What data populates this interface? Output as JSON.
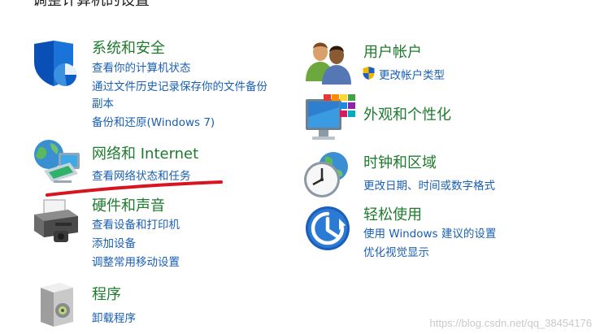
{
  "header": {
    "title": "调整计算机的设置"
  },
  "categories": {
    "system": {
      "title": "系统和安全",
      "links": [
        "查看你的计算机状态",
        "通过文件历史记录保存你的文件备份",
        "副本",
        "备份和还原(Windows 7)"
      ],
      "icon": "shield-icon"
    },
    "network": {
      "title": "网络和 Internet",
      "links": [
        "查看网络状态和任务"
      ],
      "icon": "network-globe-icon"
    },
    "hardware": {
      "title": "硬件和声音",
      "links": [
        "查看设备和打印机",
        "添加设备",
        "调整常用移动设置"
      ],
      "icon": "printer-icon"
    },
    "programs": {
      "title": "程序",
      "links": [
        "卸载程序"
      ],
      "icon": "programs-box-icon"
    },
    "users": {
      "title": "用户帐户",
      "links": [
        "更改帐户类型"
      ],
      "icon": "users-icon",
      "link_icon": "uac-shield-icon"
    },
    "appearance": {
      "title": "外观和个性化",
      "links": [],
      "icon": "monitor-palette-icon"
    },
    "clock": {
      "title": "时钟和区域",
      "links": [
        "更改日期、时间或数字格式"
      ],
      "icon": "clock-globe-icon"
    },
    "ease": {
      "title": "轻松使用",
      "links": [
        "使用 Windows 建议的设置",
        "优化视觉显示"
      ],
      "icon": "ease-of-access-icon"
    }
  },
  "annotation": {
    "color": "#d8141e"
  },
  "watermark": "https://blog.csdn.net/qq_38454176"
}
